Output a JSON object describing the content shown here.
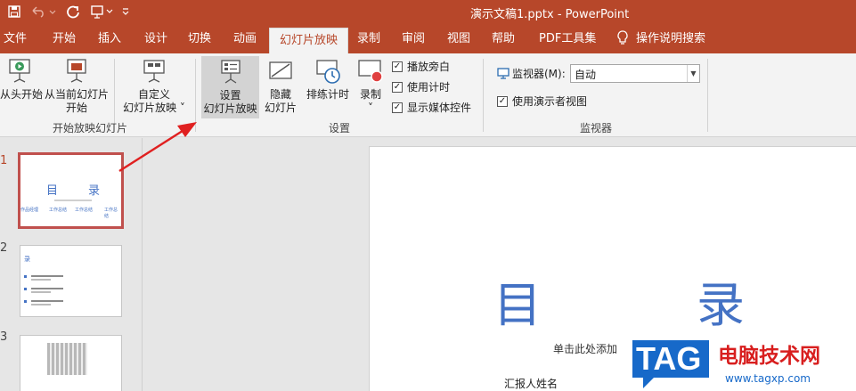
{
  "titlebar": {
    "title": "演示文稿1.pptx  -  PowerPoint",
    "qa": {
      "save_icon": "save-icon",
      "undo_icon": "undo-icon",
      "redo_icon": "redo-icon",
      "present_icon": "present-from-start-icon",
      "customize_icon": "customize-qat-icon"
    }
  },
  "tabs": [
    "文件",
    "开始",
    "插入",
    "设计",
    "切换",
    "动画",
    "幻灯片放映",
    "录制",
    "审阅",
    "视图",
    "帮助",
    "PDF工具集",
    "操作说明搜索"
  ],
  "active_tab": "幻灯片放映",
  "ribbon": {
    "start_group": {
      "label": "开始放映幻灯片",
      "from_beginning": "从头开始",
      "from_current_1": "从当前幻灯片",
      "from_current_2": "开始",
      "custom_1": "自定义",
      "custom_2": "幻灯片放映 ˅"
    },
    "setup_group": {
      "label": "设置",
      "setup_1": "设置",
      "setup_2": "幻灯片放映",
      "hide_1": "隐藏",
      "hide_2": "幻灯片",
      "rehearse": "排练计时",
      "record": "录制",
      "record_arrow": "˅",
      "chk_narration": "播放旁白",
      "chk_timing": "使用计时",
      "chk_media": "显示媒体控件"
    },
    "monitor_group": {
      "label": "监视器",
      "monitor_label": "监视器(M):",
      "monitor_value": "自动",
      "presenter_view": "使用演示者视图"
    }
  },
  "slides": [
    {
      "number": "1",
      "title_left": "目",
      "title_right": "录",
      "items": [
        "作品经理",
        "工作总结",
        "工作总结",
        "工作总结"
      ]
    },
    {
      "number": "2",
      "title": "录"
    },
    {
      "number": "3"
    }
  ],
  "main_slide": {
    "title_left": "目",
    "title_right": "录",
    "subtitle": "单击此处添加",
    "reporter": "汇报人姓名"
  },
  "watermark": {
    "tag": "TAG",
    "site_name": "电脑技术网",
    "url": "www.tagxp.com"
  },
  "colors": {
    "accent": "#b7472a",
    "title_blue": "#4472c4",
    "arrow_red": "#e02020"
  }
}
